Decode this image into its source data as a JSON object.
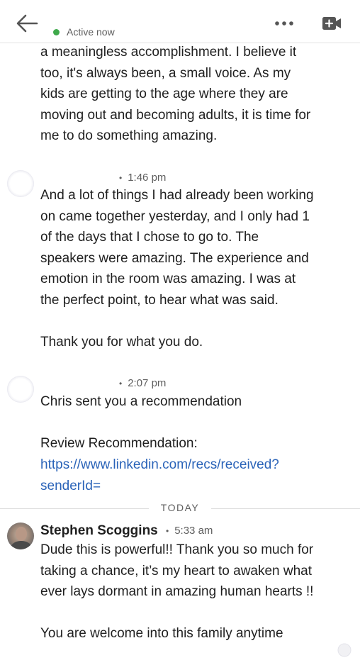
{
  "header": {
    "status_text": "Active now",
    "status_color": "#3fa94b",
    "back_icon": "arrow-left-icon",
    "more_icon": "more-horizontal-icon",
    "video_icon": "video-call-icon"
  },
  "messages": [
    {
      "text": "a meaningless accomplishment.  I believe it\ntoo, it's always been, a small voice.  As my\nkids are getting to the age where they are\nmoving out and becoming adults, it is time for\nme to do something amazing."
    },
    {
      "time": "1:46 pm",
      "text": "And a lot of things I had already been working\non came together yesterday, and I only had 1\nof the days that I chose to go to.  The\nspeakers were amazing.  The experience and\nemotion in the room was amazing.  I was at\nthe perfect point, to hear what was said.\n\nThank you for what you do."
    },
    {
      "time": "2:07 pm",
      "text": "Chris sent you a recommendation\n\nReview Recommendation:",
      "link_line1": "https://www.linkedin.com/recs/received?",
      "link_line2": "senderId="
    }
  ],
  "divider": {
    "label": "TODAY"
  },
  "latest": {
    "sender": "Stephen Scoggins",
    "time": "5:33 am",
    "text": "Dude this is powerful!! Thank you so much for\ntaking a chance, it’s my heart to awaken what\never lays dormant in amazing human hearts !!\n\nYou are welcome into this family anytime"
  },
  "link_color": "#2a63b8"
}
